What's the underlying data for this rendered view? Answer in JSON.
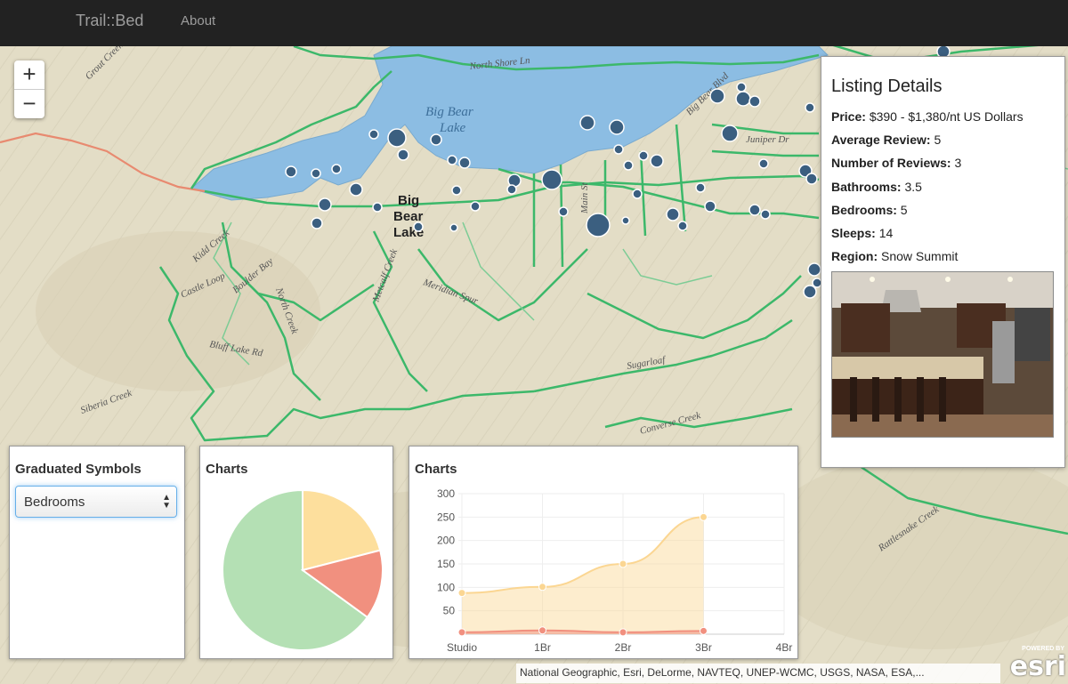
{
  "navbar": {
    "brand": "Trail::Bed",
    "about": "About"
  },
  "map": {
    "zoom_in": "+",
    "zoom_out": "−",
    "labels": {
      "north_shore": "North Shore Ln",
      "big_bear_lake_water": "Big Bear",
      "big_bear_lake_water2": "Lake",
      "town1": "Big",
      "town2": "Bear",
      "town3": "Lake",
      "kidd_creek": "Kidd Creek",
      "castle_loop": "Castle Loop",
      "boulder_bay": "Boulder Bay",
      "north_creek": "North Creek",
      "metcalf_creek": "Metcalf Creek",
      "meridian_spur": "Meridian Spur",
      "siberia_creek": "Siberia Creek",
      "bluff_lake_rd": "Bluff Lake Rd",
      "sugarloaf": "Sugarloaf",
      "converse_creek": "Converse Creek",
      "rattlesnake_creek": "Rattlesnake Creek",
      "big_bear_blvd": "Big Bear Blvd",
      "grout_creek": "Grout Creek",
      "juniper_dr": "Juniper Dr",
      "main_st": "Main St"
    }
  },
  "symbols_panel": {
    "title": "Graduated Symbols",
    "selected": "Bedrooms"
  },
  "pie_panel": {
    "title": "Charts"
  },
  "line_panel": {
    "title": "Charts"
  },
  "details": {
    "title": "Listing Details",
    "rows": [
      {
        "label": "Price:",
        "value": "$390 - $1,380/nt US Dollars"
      },
      {
        "label": "Average Review:",
        "value": "5"
      },
      {
        "label": "Number of Reviews:",
        "value": "3"
      },
      {
        "label": "Bathrooms:",
        "value": "3.5"
      },
      {
        "label": "Bedrooms:",
        "value": "5"
      },
      {
        "label": "Sleeps:",
        "value": "14"
      },
      {
        "label": "Region:",
        "value": "Snow Summit"
      }
    ]
  },
  "attribution": "National Geographic, Esri, DeLorme, NAVTEQ, UNEP-WCMC, USGS, NASA, ESA,...",
  "esri": {
    "powered": "POWERED BY",
    "word": "esri"
  },
  "chart_data": [
    {
      "type": "pie",
      "values": [
        65,
        21,
        14
      ],
      "colors": [
        "#b4e0b4",
        "#fddf9d",
        "#f1907f"
      ]
    },
    {
      "type": "area",
      "categories": [
        "Studio",
        "1Br",
        "2Br",
        "3Br",
        "4Br"
      ],
      "ylim": [
        0,
        300
      ],
      "yticks": [
        50,
        100,
        150,
        200,
        250,
        300
      ],
      "grid": true,
      "series": [
        {
          "values": [
            88,
            101,
            150,
            250
          ],
          "color": "#fbd692"
        },
        {
          "values": [
            4,
            8,
            4,
            7
          ],
          "color": "#f1907f"
        }
      ]
    }
  ]
}
